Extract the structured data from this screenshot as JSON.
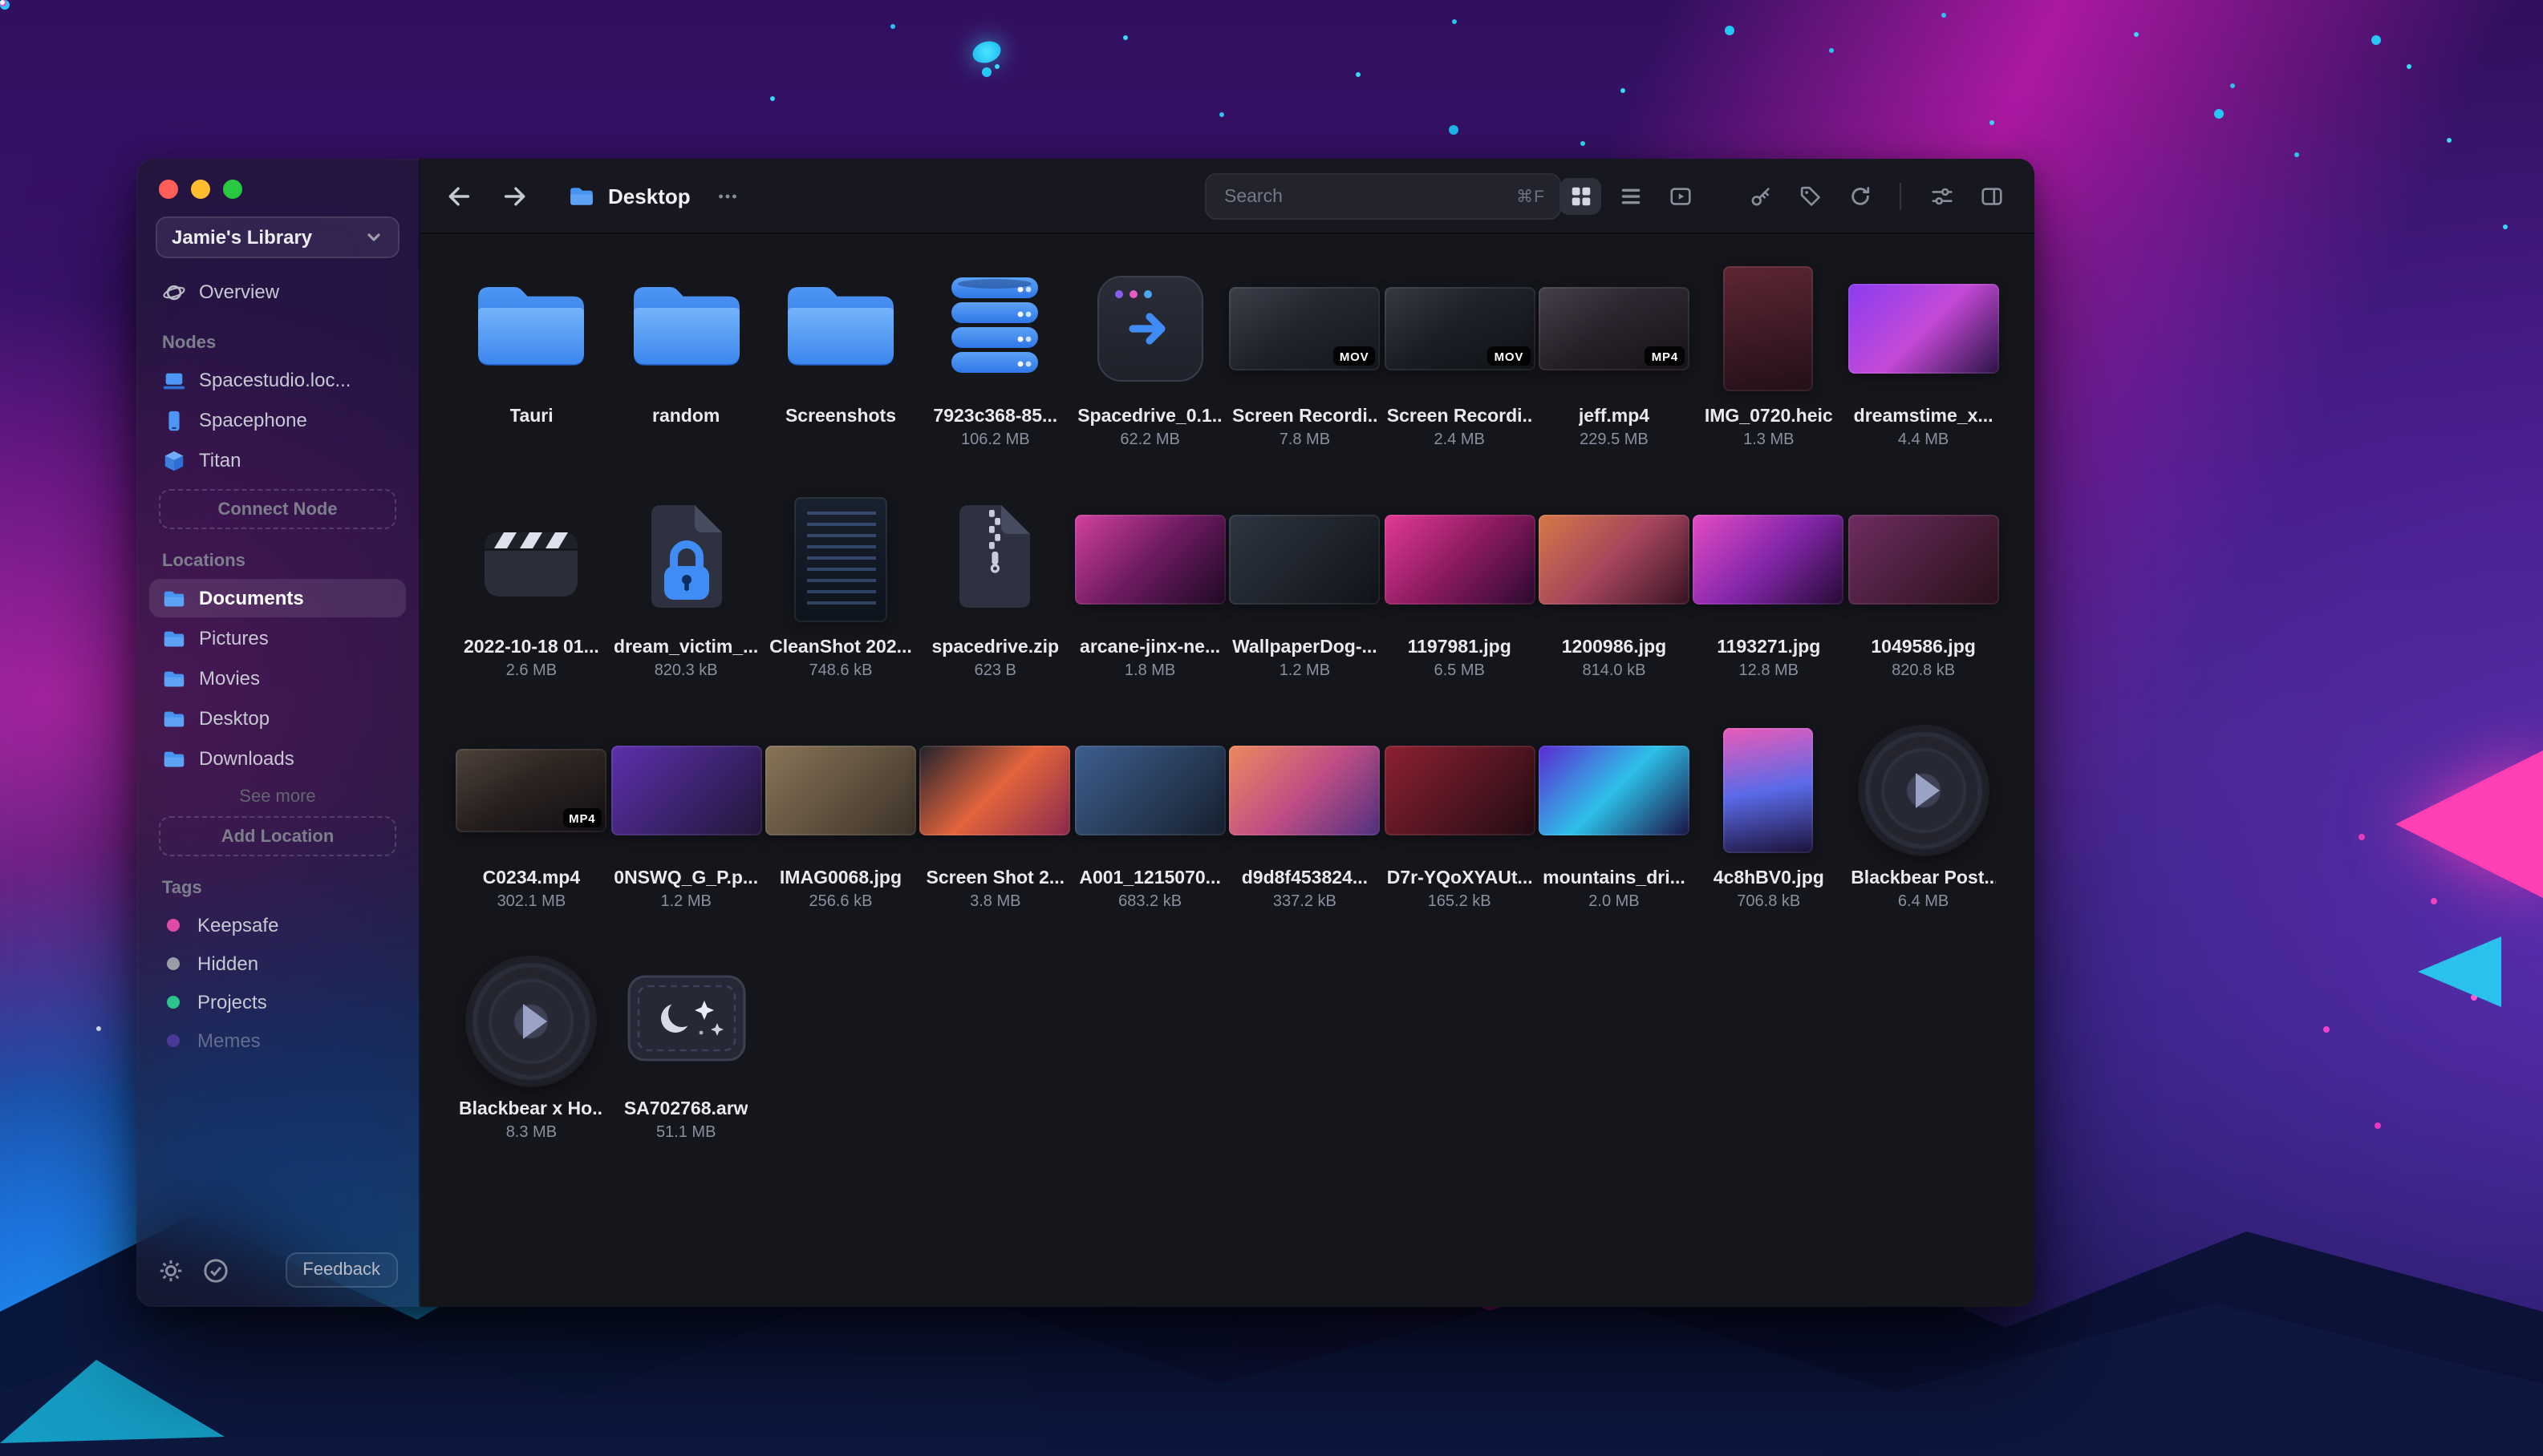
{
  "window": {
    "traffic_lights": [
      "close",
      "minimize",
      "zoom"
    ]
  },
  "sidebar": {
    "library_name": "Jamie's Library",
    "overview": "Overview",
    "nodes": {
      "header": "Nodes",
      "items": [
        {
          "label": "Spacestudio.loc...",
          "icon": "laptop-icon"
        },
        {
          "label": "Spacephone",
          "icon": "phone-icon"
        },
        {
          "label": "Titan",
          "icon": "server-icon"
        }
      ],
      "connect_button": "Connect Node"
    },
    "locations": {
      "header": "Locations",
      "items": [
        {
          "label": "Documents",
          "selected": true
        },
        {
          "label": "Pictures",
          "selected": false
        },
        {
          "label": "Movies",
          "selected": false
        },
        {
          "label": "Desktop",
          "selected": false
        },
        {
          "label": "Downloads",
          "selected": false
        }
      ],
      "see_more": "See more",
      "add_button": "Add Location"
    },
    "tags": {
      "header": "Tags",
      "items": [
        {
          "label": "Keepsafe",
          "color": "#E14BA5",
          "dimmed": false
        },
        {
          "label": "Hidden",
          "color": "#9B9DA6",
          "dimmed": false
        },
        {
          "label": "Projects",
          "color": "#2BC48A",
          "dimmed": false
        },
        {
          "label": "Memes",
          "color": "#8850E8",
          "dimmed": true
        }
      ]
    },
    "footer": {
      "icons": [
        "gear-icon",
        "check-circle-icon"
      ],
      "feedback_label": "Feedback"
    }
  },
  "topbar": {
    "title": "Desktop",
    "search_placeholder": "Search",
    "search_shortcut": "⌘F",
    "view_modes": [
      {
        "name": "grid-view",
        "active": true
      },
      {
        "name": "list-view",
        "active": false
      },
      {
        "name": "media-view",
        "active": false
      }
    ],
    "tools": [
      "key",
      "tag",
      "refresh"
    ],
    "panel_tools": [
      "filters",
      "layout-sidebar"
    ]
  },
  "explorer": {
    "items": [
      {
        "name": "Tauri",
        "size": null,
        "thumb": {
          "type": "folder"
        }
      },
      {
        "name": "random",
        "size": null,
        "thumb": {
          "type": "folder"
        }
      },
      {
        "name": "Screenshots",
        "size": null,
        "thumb": {
          "type": "folder"
        }
      },
      {
        "name": "7923c368-85...",
        "size": "106.2 MB",
        "thumb": {
          "type": "database"
        }
      },
      {
        "name": "Spacedrive_0.1...",
        "size": "62.2 MB",
        "thumb": {
          "type": "app",
          "dot_colors": [
            "#8A5CF0",
            "#E85CC8",
            "#4AA8F0"
          ]
        }
      },
      {
        "name": "Screen Recordi...",
        "size": "7.8 MB",
        "thumb": {
          "type": "video",
          "badge": "MOV",
          "colors": [
            "#2c313b",
            "#14161d"
          ]
        }
      },
      {
        "name": "Screen Recordi...",
        "size": "2.4 MB",
        "thumb": {
          "type": "video",
          "badge": "MOV",
          "colors": [
            "#262a33",
            "#101217"
          ]
        }
      },
      {
        "name": "jeff.mp4",
        "size": "229.5 MB",
        "thumb": {
          "type": "video",
          "badge": "MP4",
          "colors": [
            "#37313b",
            "#171219"
          ]
        }
      },
      {
        "name": "IMG_0720.heic",
        "size": "1.3 MB",
        "thumb": {
          "type": "photo-portrait",
          "colors": [
            "#5e2633",
            "#220f18"
          ]
        }
      },
      {
        "name": "dreamstime_x...",
        "size": "4.4 MB",
        "thumb": {
          "type": "photo",
          "colors": [
            "#8a3cf0",
            "#c44ad8",
            "#2a1244"
          ]
        }
      },
      {
        "name": "2022-10-18 01...",
        "size": "2.6 MB",
        "thumb": {
          "type": "clapper"
        }
      },
      {
        "name": "dream_victim_...",
        "size": "820.3 kB",
        "thumb": {
          "type": "lockdoc"
        }
      },
      {
        "name": "CleanShot 202...",
        "size": "748.6 kB",
        "thumb": {
          "type": "screenshot-tall",
          "colors": [
            "#18212e",
            "#0e131c"
          ]
        }
      },
      {
        "name": "spacedrive.zip",
        "size": "623 B",
        "thumb": {
          "type": "zip"
        }
      },
      {
        "name": "arcane-jinx-ne...",
        "size": "1.8 MB",
        "thumb": {
          "type": "photo",
          "colors": [
            "#d2419e",
            "#6c1a60",
            "#1e0a24"
          ]
        }
      },
      {
        "name": "WallpaperDog-...",
        "size": "1.2 MB",
        "thumb": {
          "type": "photo",
          "colors": [
            "#2e3540",
            "#10131a"
          ]
        }
      },
      {
        "name": "1197981.jpg",
        "size": "6.5 MB",
        "thumb": {
          "type": "photo",
          "colors": [
            "#e23a96",
            "#8a1a5e",
            "#2c0a30"
          ]
        }
      },
      {
        "name": "1200986.jpg",
        "size": "814.0 kB",
        "thumb": {
          "type": "photo",
          "colors": [
            "#d57a48",
            "#a4445c",
            "#381424"
          ]
        }
      },
      {
        "name": "1193271.jpg",
        "size": "12.8 MB",
        "thumb": {
          "type": "photo",
          "colors": [
            "#e44cc4",
            "#8426aa",
            "#260b36"
          ]
        }
      },
      {
        "name": "1049586.jpg",
        "size": "820.8 kB",
        "thumb": {
          "type": "photo",
          "colors": [
            "#6e2c60",
            "#281119"
          ]
        }
      },
      {
        "name": "C0234.mp4",
        "size": "302.1 MB",
        "thumb": {
          "type": "video",
          "badge": "MP4",
          "colors": [
            "#40332b",
            "#110e13"
          ]
        }
      },
      {
        "name": "0NSWQ_G_P.p...",
        "size": "1.2 MB",
        "thumb": {
          "type": "photo",
          "colors": [
            "#5c30ac",
            "#221739"
          ]
        }
      },
      {
        "name": "IMAG0068.jpg",
        "size": "256.6 kB",
        "thumb": {
          "type": "photo",
          "colors": [
            "#887458",
            "#3c3228"
          ]
        }
      },
      {
        "name": "Screen Shot 2...",
        "size": "3.8 MB",
        "thumb": {
          "type": "photo",
          "colors": [
            "#20222c",
            "#e2643c",
            "#8a2a4e"
          ]
        }
      },
      {
        "name": "A001_1215070...",
        "size": "683.2 kB",
        "thumb": {
          "type": "photo",
          "colors": [
            "#3e5e8e",
            "#16202e"
          ]
        }
      },
      {
        "name": "d9d8f453824...",
        "size": "337.2 kB",
        "thumb": {
          "type": "photo",
          "colors": [
            "#ec8a5e",
            "#c04e84",
            "#503080"
          ]
        }
      },
      {
        "name": "D7r-YQoXYAUt...",
        "size": "165.2 kB",
        "thumb": {
          "type": "photo",
          "colors": [
            "#8c2030",
            "#220c14"
          ]
        }
      },
      {
        "name": "mountains_dri...",
        "size": "2.0 MB",
        "thumb": {
          "type": "photo",
          "colors": [
            "#5c2ad2",
            "#2ec0e8",
            "#1a1144"
          ]
        }
      },
      {
        "name": "4c8hBV0.jpg",
        "size": "706.8 kB",
        "thumb": {
          "type": "photo-portrait",
          "colors": [
            "#ea5ab8",
            "#5a6ae8",
            "#1c1238"
          ]
        }
      },
      {
        "name": "Blackbear Post...",
        "size": "6.4 MB",
        "thumb": {
          "type": "vinyl"
        }
      },
      {
        "name": "Blackbear x Ho...",
        "size": "8.3 MB",
        "thumb": {
          "type": "vinyl"
        }
      },
      {
        "name": "SA702768.arw",
        "size": "51.1 MB",
        "thumb": {
          "type": "raw"
        }
      }
    ]
  },
  "colors": {
    "accent": "#3F8CF5",
    "background": "#16171D",
    "folder_blue": "#4795F2"
  }
}
